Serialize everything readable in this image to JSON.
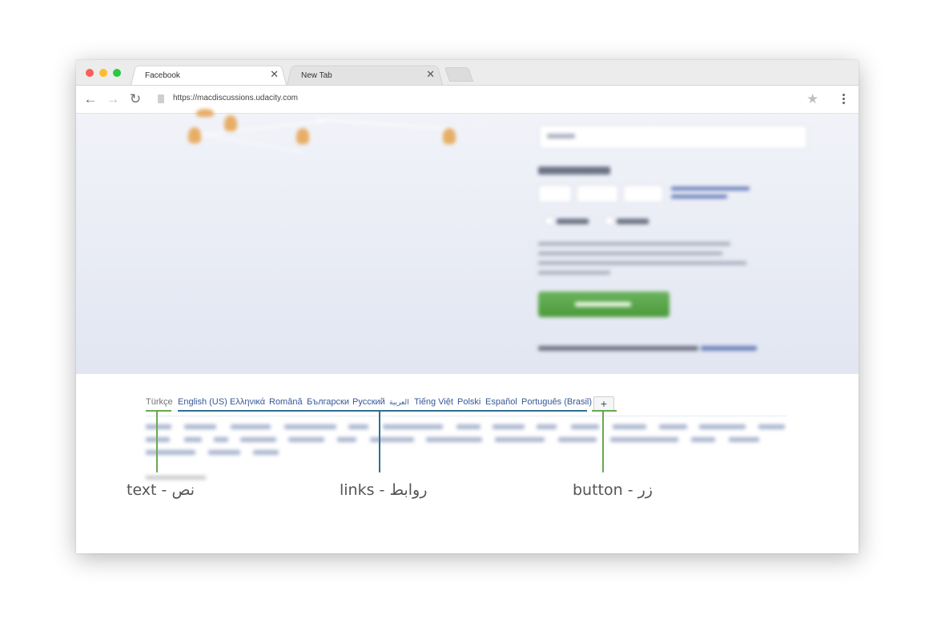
{
  "browser": {
    "tabs": [
      {
        "title": "Facebook",
        "close": "✕"
      },
      {
        "title": "New Tab",
        "close": "✕"
      }
    ],
    "url": "https://macdiscussions.udacity.com",
    "icons": {
      "back": "←",
      "forward": "→",
      "reload": "↻",
      "bookmark": "★"
    }
  },
  "footer": {
    "current_language": "Türkçe",
    "languages": [
      "English (US)",
      "Ελληνικά",
      "Română",
      "Български",
      "Русский",
      "العربية",
      "Tiếng Việt",
      "Polski",
      "Español",
      "Português (Brasil)"
    ],
    "more_button": "+"
  },
  "annotations": {
    "text": "text - نص",
    "links": "links - روابط",
    "button": "button - زر"
  },
  "colors": {
    "text_marker": "#6aa84f",
    "links_marker": "#2f6f8f",
    "button_marker": "#6aa84f"
  }
}
